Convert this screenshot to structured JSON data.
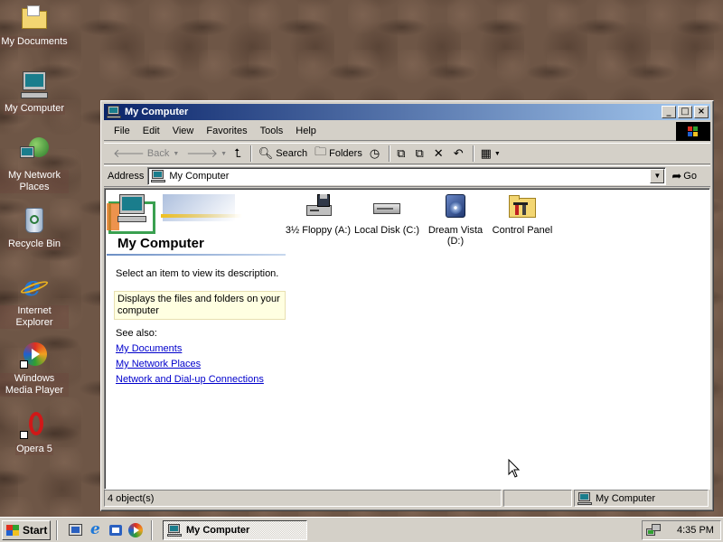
{
  "desktop": {
    "icons": [
      {
        "label": "My Documents",
        "icon": "folder-icon"
      },
      {
        "label": "My Computer",
        "icon": "computer-icon"
      },
      {
        "label": "My Network Places",
        "icon": "network-icon"
      },
      {
        "label": "Recycle Bin",
        "icon": "recycle-bin-icon"
      },
      {
        "label": "Internet Explorer",
        "icon": "internet-explorer-icon"
      },
      {
        "label": "Windows Media Player",
        "icon": "media-player-icon"
      },
      {
        "label": "Opera 5",
        "icon": "opera-icon"
      }
    ]
  },
  "window": {
    "title": "My Computer",
    "menu": [
      "File",
      "Edit",
      "View",
      "Favorites",
      "Tools",
      "Help"
    ],
    "toolbar": {
      "back": "Back",
      "search": "Search",
      "folders": "Folders"
    },
    "address": {
      "label": "Address",
      "value": "My Computer",
      "go": "Go"
    },
    "left_pane": {
      "title": "My Computer",
      "prompt": "Select an item to view its description.",
      "description": "Displays the files and folders on your computer",
      "see_also": "See also:",
      "links": [
        "My Documents",
        "My Network Places",
        "Network and Dial-up Connections"
      ]
    },
    "items": [
      {
        "label": "3½ Floppy (A:)",
        "icon": "floppy-drive-icon"
      },
      {
        "label": "Local Disk (C:)",
        "icon": "hard-disk-icon"
      },
      {
        "label": "Dream Vista (D:)",
        "icon": "cd-drive-icon"
      },
      {
        "label": "Control Panel",
        "icon": "control-panel-icon"
      }
    ],
    "status": {
      "count": "4 object(s)",
      "location": "My Computer"
    }
  },
  "taskbar": {
    "start": "Start",
    "task": "My Computer",
    "clock": "4:35 PM"
  },
  "colors": {
    "titlebar_start": "#0a246a",
    "titlebar_end": "#a6caf0",
    "face": "#d4d0c8",
    "link": "#0000cc"
  }
}
